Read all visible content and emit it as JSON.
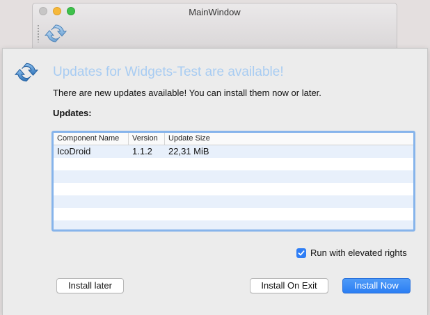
{
  "window": {
    "title": "MainWindow"
  },
  "dialog": {
    "heading": "Updates for Widgets-Test are available!",
    "info": "There are new updates available! You can install them now or later.",
    "updates_label": "Updates:"
  },
  "table": {
    "columns": [
      "Component Name",
      "Version",
      "Update Size"
    ],
    "rows": [
      [
        "IcoDroid",
        "1.1.2",
        "22,31 MiB"
      ]
    ]
  },
  "options": {
    "elevated_label": "Run with elevated rights",
    "elevated_checked": true
  },
  "buttons": {
    "install_later": "Install later",
    "install_on_exit": "Install On Exit",
    "install_now": "Install Now"
  },
  "icons": {
    "app_icon": "refresh-icon",
    "toolbar_icon": "refresh-icon",
    "checkbox": "checkmark-icon"
  },
  "colors": {
    "heading": "#a8ccf2",
    "accent": "#2f7ef5",
    "table_focus": "#86b4eb",
    "row_alt": "#e8f0fb"
  }
}
